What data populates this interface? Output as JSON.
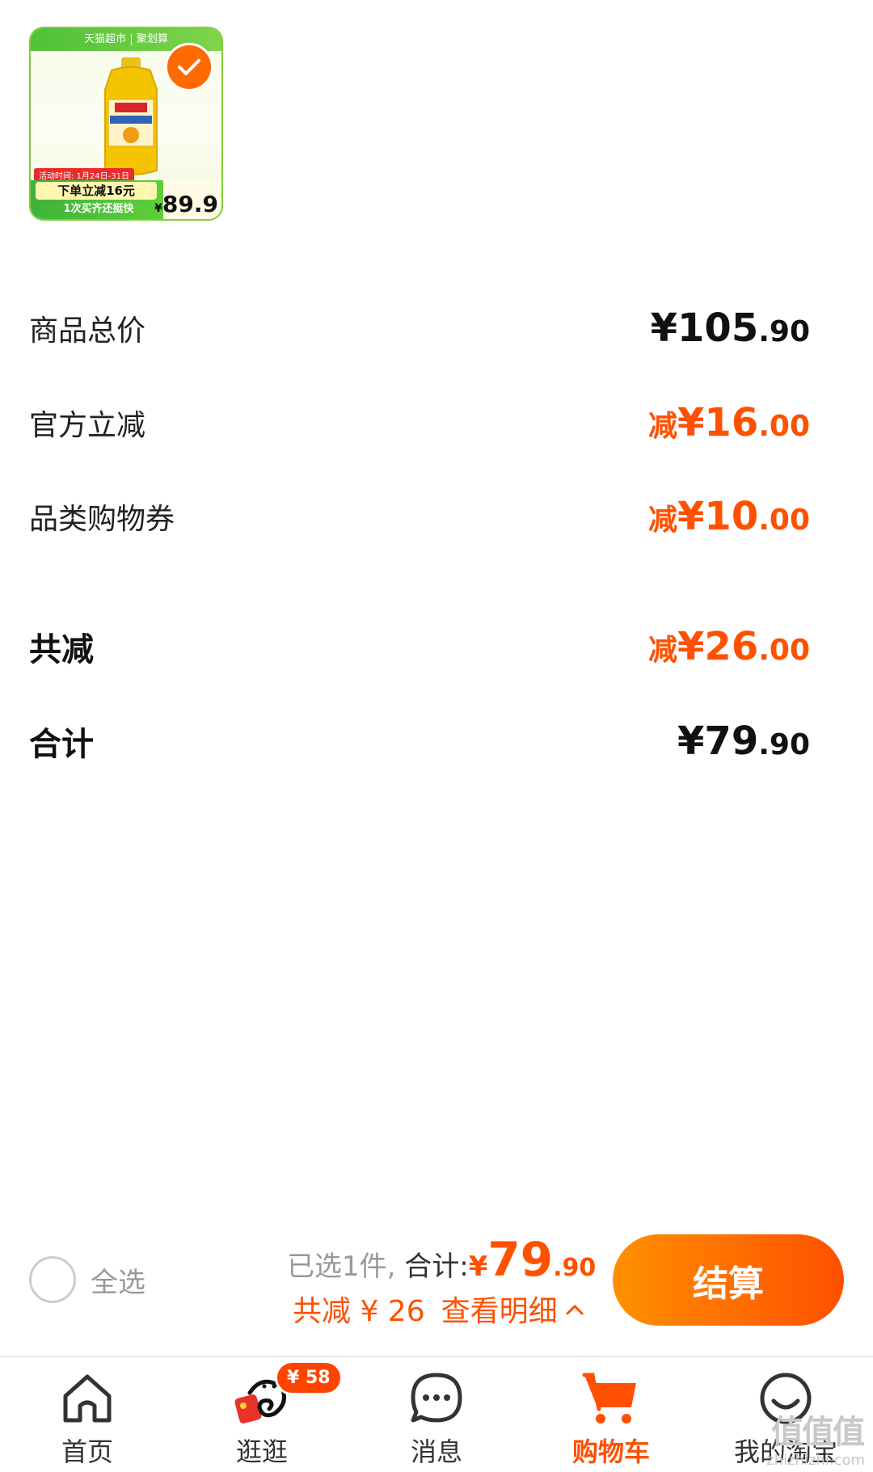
{
  "product": {
    "banner_text": "天猫超市 | 聚划算",
    "brand_label": "鲁花",
    "product_label": "压榨葵花仁油",
    "promo_date": "活动时间: 1月24日-31日",
    "promo_line1": "下单立减16元",
    "promo_line2": "1次买齐还挺快",
    "promo_price_currency": "¥",
    "promo_price": "89.9"
  },
  "breakdown": {
    "subtotal_label": "商品总价",
    "subtotal_amount_int": "¥105",
    "subtotal_amount_dec": ".90",
    "official_label": "官方立减",
    "official_prefix": "减",
    "official_amount_int": "¥16",
    "official_amount_dec": ".00",
    "coupon_label": "品类购物券",
    "coupon_prefix": "减",
    "coupon_amount_int": "¥10",
    "coupon_amount_dec": ".00",
    "total_discount_label": "共减",
    "total_discount_prefix": "减",
    "total_discount_int": "¥26",
    "total_discount_dec": ".00",
    "total_label": "合计",
    "total_amount_int": "¥79",
    "total_amount_dec": ".90"
  },
  "bottom_bar": {
    "select_all_label": "全选",
    "selected_count_text": "已选1件,",
    "total_label": "合计:",
    "total_currency": "¥",
    "total_int": "79",
    "total_dec": ".90",
    "discount_text": "共减 ¥ 26",
    "detail_link": "查看明细",
    "checkout_label": "结算"
  },
  "tabs": [
    {
      "label": "首页",
      "icon": "home-icon"
    },
    {
      "label": "逛逛",
      "icon": "browse-icon",
      "badge": "¥ 58"
    },
    {
      "label": "消息",
      "icon": "message-icon"
    },
    {
      "label": "购物车",
      "icon": "cart-icon",
      "active": true
    },
    {
      "label": "我的淘宝",
      "icon": "profile-icon"
    }
  ],
  "watermark": {
    "big": "值值值",
    "small": "zhizhizhi.com"
  },
  "colors": {
    "accent": "#ff5000",
    "accent_start": "#ff9000",
    "text": "#111111",
    "muted": "#999999"
  }
}
